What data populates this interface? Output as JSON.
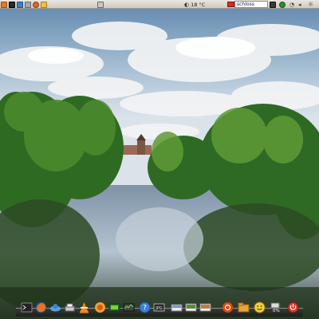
{
  "top_panel": {
    "left_icons": [
      "menu-icon",
      "terminal-icon",
      "mail-icon",
      "folder-icon",
      "firefox-icon",
      "notes-icon",
      "printer-icon"
    ],
    "weather": {
      "icon": "moon-icon",
      "temperature": "18 °C"
    },
    "search": {
      "value": "schloss",
      "engine_flag_color": "#d42a2a"
    },
    "right_icons": [
      "network-icon",
      "update-icon",
      "clock-icon",
      "sound-icon",
      "brightness-icon"
    ]
  },
  "dock": {
    "items": [
      "terminal-icon",
      "firefox-icon",
      "network-icon",
      "vlc-icon",
      "firefox-icon",
      "video-icon",
      "system-monitor-icon",
      "help-icon",
      "image-icon",
      "folder-icon",
      "photo-icon",
      "photos-icon",
      "ubuntu-icon",
      "files-icon",
      "smiley-icon",
      "battery-icon",
      "power-icon"
    ],
    "battery_percent": "0%"
  }
}
